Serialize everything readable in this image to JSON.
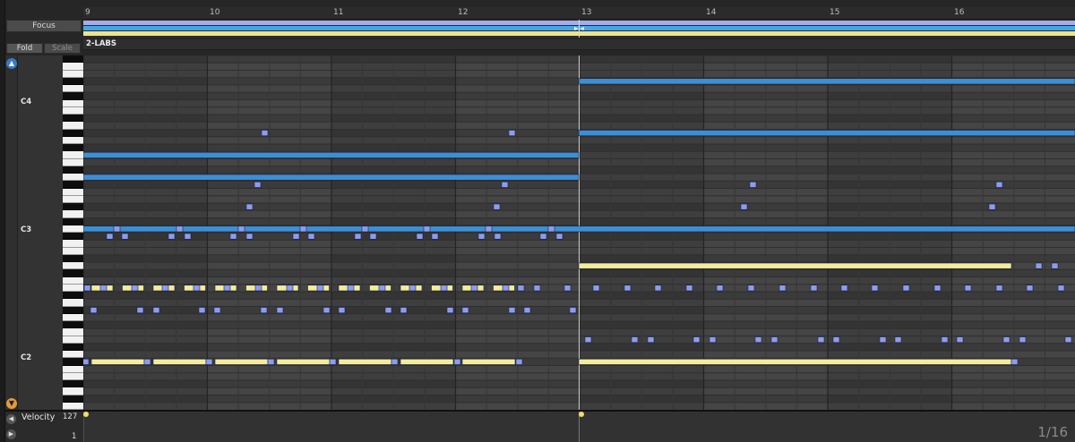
{
  "buttons": {
    "focus": "Focus",
    "fold": "Fold",
    "scale": "Scale"
  },
  "clip": {
    "name": "2-LABS"
  },
  "ruler": {
    "bars": [
      "9",
      "10",
      "11",
      "12",
      "13",
      "14",
      "15",
      "16"
    ]
  },
  "keyboard": {
    "labels": [
      "C4",
      "C3",
      "C2"
    ]
  },
  "velocity": {
    "label": "Velocity",
    "max": "127",
    "min": "1"
  },
  "grid": {
    "quantization": "1/16"
  },
  "colors": {
    "note_blue": "#3d8fd4",
    "note_yellow": "#f4ec99",
    "note_lavender": "#8e9cef",
    "loop_lavender": "#a3ade9",
    "loop_blue": "#45a6e6",
    "loop_yellow": "#ece38f",
    "velocity_marker": "#f1dc6a"
  },
  "icons": {
    "scroll_up": "up-arrow-circle-icon",
    "scroll_down": "down-arrow-circle-icon",
    "velocity_toggle": "collapse-arrow-icon",
    "velocity_play": "play-triangle-icon"
  }
}
